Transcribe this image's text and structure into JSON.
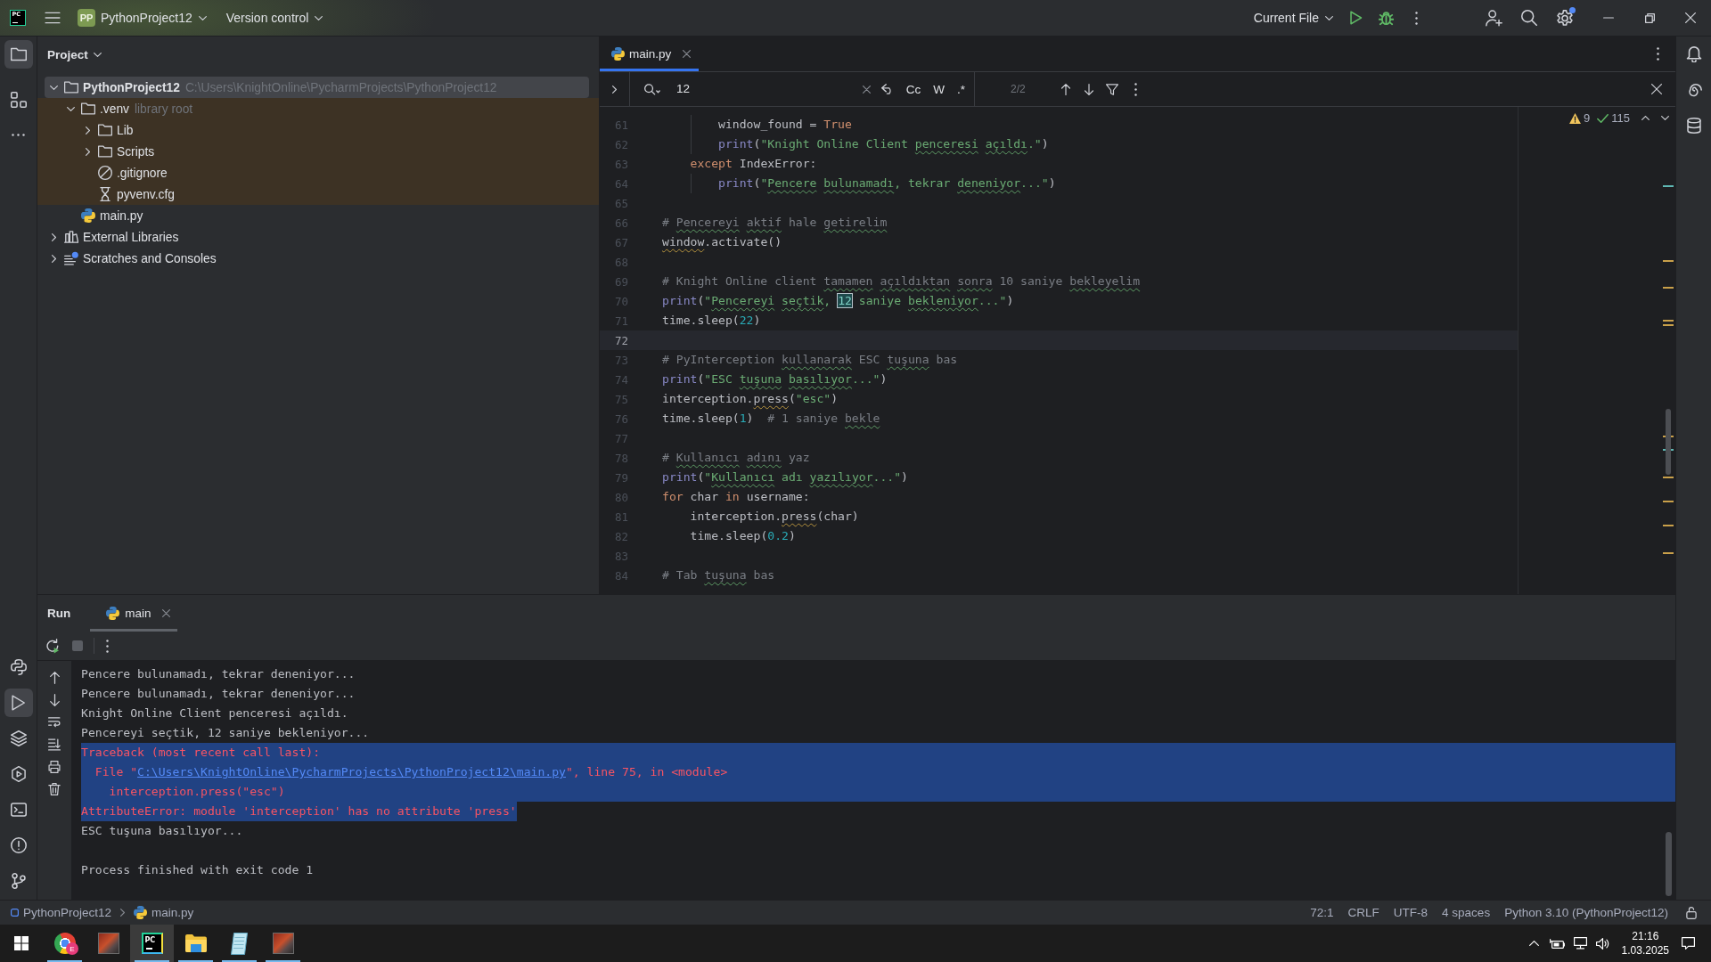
{
  "title_bar": {
    "logo_text": "PC",
    "project_initials": "PP",
    "project": "PythonProject12",
    "vcs": "Version control",
    "run_config": "Current File",
    "settings_notification": true
  },
  "left_toolbar": {
    "top": [
      {
        "kind": "project",
        "selected": true
      },
      {
        "kind": "structure",
        "selected": false
      }
    ],
    "bottom": [
      {
        "kind": "python-console",
        "selected": false
      },
      {
        "kind": "run",
        "selected": true
      },
      {
        "kind": "packages",
        "selected": false
      },
      {
        "kind": "services",
        "selected": false
      },
      {
        "kind": "terminal",
        "selected": false
      },
      {
        "kind": "problems",
        "selected": false
      },
      {
        "kind": "git",
        "selected": false
      }
    ]
  },
  "project_panel": {
    "title": "Project",
    "tree": [
      {
        "kind": "project",
        "label": "PythonProject12",
        "hint": "C:\\Users\\KnightOnline\\PycharmProjects\\PythonProject12",
        "expanded": true,
        "selected": true,
        "library_scope": false,
        "children": [
          {
            "kind": "folder",
            "label": ".venv",
            "hint": "library root",
            "expanded": true,
            "selected": false,
            "library_scope": true,
            "children": [
              {
                "kind": "folder",
                "label": "Lib",
                "expanded": false,
                "selected": false,
                "library_scope": true
              },
              {
                "kind": "folder",
                "label": "Scripts",
                "expanded": false,
                "selected": false,
                "library_scope": true
              },
              {
                "kind": "ignore-file",
                "label": ".gitignore",
                "selected": false,
                "library_scope": true
              },
              {
                "kind": "config-file",
                "label": "pyvenv.cfg",
                "selected": false,
                "library_scope": true
              }
            ]
          },
          {
            "kind": "python-file",
            "label": "main.py",
            "selected": false,
            "library_scope": false
          }
        ]
      },
      {
        "kind": "libraries",
        "label": "External Libraries",
        "expanded": false,
        "selected": false,
        "library_scope": false
      },
      {
        "kind": "scratches",
        "label": "Scratches and Consoles",
        "expanded": false,
        "selected": false,
        "library_scope": false
      }
    ]
  },
  "editor": {
    "tabs": [
      {
        "label": "main.py",
        "selected": true
      }
    ],
    "find": {
      "query": "12",
      "options": [
        {
          "label": "Cc",
          "on": false
        },
        {
          "label": "W",
          "on": false
        },
        {
          "label": ".*",
          "on": false
        }
      ],
      "result": "2/2"
    },
    "inspections": {
      "warnings": "9",
      "passed": "115"
    },
    "lines": [
      {
        "number": "61",
        "current": false,
        "tokens": [
          {
            "kind": "plain",
            "text": "        window_found = "
          },
          {
            "kind": "keyword",
            "text": "True"
          }
        ]
      },
      {
        "number": "62",
        "current": false,
        "tokens": [
          {
            "kind": "builtin",
            "text": "        print"
          },
          {
            "kind": "plain",
            "text": "("
          },
          {
            "kind": "string",
            "text": "\"Knight Online Client "
          },
          {
            "kind": "string",
            "text": "penceresi",
            "typo": true
          },
          {
            "kind": "string",
            "text": " açıldı",
            "typo": true
          },
          {
            "kind": "string",
            "text": ".\""
          },
          {
            "kind": "plain",
            "text": ")"
          }
        ]
      },
      {
        "number": "63",
        "current": false,
        "tokens": [
          {
            "kind": "keyword",
            "text": "    except"
          },
          {
            "kind": "plain",
            "text": " IndexError:"
          }
        ]
      },
      {
        "number": "64",
        "current": false,
        "tokens": [
          {
            "kind": "builtin",
            "text": "        print"
          },
          {
            "kind": "plain",
            "text": "("
          },
          {
            "kind": "string",
            "text": "\""
          },
          {
            "kind": "string",
            "text": "Pencere",
            "typo": true
          },
          {
            "kind": "string",
            "text": " bulunamadı",
            "typo": true
          },
          {
            "kind": "string",
            "text": ", tekrar "
          },
          {
            "kind": "string",
            "text": "deneniyor",
            "typo": true
          },
          {
            "kind": "string",
            "text": "...\""
          },
          {
            "kind": "plain",
            "text": ")"
          }
        ]
      },
      {
        "number": "65",
        "current": false
      },
      {
        "number": "66",
        "current": false,
        "tokens": [
          {
            "kind": "comment",
            "text": "# "
          },
          {
            "kind": "comment",
            "text": "Pencereyi",
            "typo": true
          },
          {
            "kind": "comment",
            "text": " aktif",
            "typo": true
          },
          {
            "kind": "comment",
            "text": " hale "
          },
          {
            "kind": "comment",
            "text": "getirelim",
            "typo": true
          }
        ]
      },
      {
        "number": "67",
        "current": false,
        "tokens": [
          {
            "kind": "plain",
            "text": "window",
            "warning": true
          },
          {
            "kind": "plain",
            "text": ".activate()"
          }
        ]
      },
      {
        "number": "68",
        "current": false
      },
      {
        "number": "69",
        "current": false,
        "tokens": [
          {
            "kind": "comment",
            "text": "# Knight Online client "
          },
          {
            "kind": "comment",
            "text": "tamamen",
            "typo": true
          },
          {
            "kind": "comment",
            "text": " açıldıktan",
            "typo": true
          },
          {
            "kind": "comment",
            "text": " sonra",
            "typo": true
          },
          {
            "kind": "comment",
            "text": " 10 saniye "
          },
          {
            "kind": "comment",
            "text": "bekleyelim",
            "typo": true
          }
        ]
      },
      {
        "number": "70",
        "current": false,
        "tokens": [
          {
            "kind": "builtin",
            "text": "print"
          },
          {
            "kind": "plain",
            "text": "("
          },
          {
            "kind": "string",
            "text": "\""
          },
          {
            "kind": "string",
            "text": "Pencereyi",
            "typo": true
          },
          {
            "kind": "string",
            "text": " seçtik",
            "typo": true
          },
          {
            "kind": "string",
            "text": ", "
          },
          {
            "kind": "match",
            "text": "12"
          },
          {
            "kind": "string",
            "text": " saniye "
          },
          {
            "kind": "string",
            "text": "bekleniyor",
            "typo": true
          },
          {
            "kind": "string",
            "text": "...\""
          },
          {
            "kind": "plain",
            "text": ")"
          }
        ]
      },
      {
        "number": "71",
        "current": false,
        "tokens": [
          {
            "kind": "plain",
            "text": "time.sleep("
          },
          {
            "kind": "number",
            "text": "22"
          },
          {
            "kind": "plain",
            "text": ")"
          }
        ]
      },
      {
        "number": "72",
        "current": true
      },
      {
        "number": "73",
        "current": false,
        "tokens": [
          {
            "kind": "comment",
            "text": "# PyInterception "
          },
          {
            "kind": "comment",
            "text": "kullanarak",
            "typo": true
          },
          {
            "kind": "comment",
            "text": " ESC "
          },
          {
            "kind": "comment",
            "text": "tuşuna",
            "typo": true
          },
          {
            "kind": "comment",
            "text": " bas"
          }
        ]
      },
      {
        "number": "74",
        "current": false,
        "tokens": [
          {
            "kind": "builtin",
            "text": "print"
          },
          {
            "kind": "plain",
            "text": "("
          },
          {
            "kind": "string",
            "text": "\"ESC "
          },
          {
            "kind": "string",
            "text": "tuşuna",
            "typo": true
          },
          {
            "kind": "string",
            "text": " basılıyor",
            "typo": true
          },
          {
            "kind": "string",
            "text": "...\""
          },
          {
            "kind": "plain",
            "text": ")"
          }
        ]
      },
      {
        "number": "75",
        "current": false,
        "tokens": [
          {
            "kind": "plain",
            "text": "interception."
          },
          {
            "kind": "plain",
            "text": "press",
            "warning": true
          },
          {
            "kind": "plain",
            "text": "("
          },
          {
            "kind": "string",
            "text": "\"esc\""
          },
          {
            "kind": "plain",
            "text": ")"
          }
        ]
      },
      {
        "number": "76",
        "current": false,
        "tokens": [
          {
            "kind": "plain",
            "text": "time.sleep("
          },
          {
            "kind": "number",
            "text": "1"
          },
          {
            "kind": "plain",
            "text": ")  "
          },
          {
            "kind": "comment",
            "text": "# 1 saniye "
          },
          {
            "kind": "comment",
            "text": "bekle",
            "typo": true
          }
        ]
      },
      {
        "number": "77",
        "current": false
      },
      {
        "number": "78",
        "current": false,
        "tokens": [
          {
            "kind": "comment",
            "text": "# "
          },
          {
            "kind": "comment",
            "text": "Kullanıcı",
            "typo": true
          },
          {
            "kind": "comment",
            "text": " adını",
            "typo": true
          },
          {
            "kind": "comment",
            "text": " yaz"
          }
        ]
      },
      {
        "number": "79",
        "current": false,
        "tokens": [
          {
            "kind": "builtin",
            "text": "print"
          },
          {
            "kind": "plain",
            "text": "("
          },
          {
            "kind": "string",
            "text": "\""
          },
          {
            "kind": "string",
            "text": "Kullanıcı",
            "typo": true
          },
          {
            "kind": "string",
            "text": " adı "
          },
          {
            "kind": "string",
            "text": "yazılıyor",
            "typo": true
          },
          {
            "kind": "string",
            "text": "...\""
          },
          {
            "kind": "plain",
            "text": ")"
          }
        ]
      },
      {
        "number": "80",
        "current": false,
        "tokens": [
          {
            "kind": "keyword",
            "text": "for"
          },
          {
            "kind": "plain",
            "text": " char "
          },
          {
            "kind": "keyword",
            "text": "in"
          },
          {
            "kind": "plain",
            "text": " username:"
          }
        ]
      },
      {
        "number": "81",
        "current": false,
        "tokens": [
          {
            "kind": "plain",
            "text": "    interception."
          },
          {
            "kind": "plain",
            "text": "press",
            "warning": true
          },
          {
            "kind": "plain",
            "text": "(char)"
          }
        ]
      },
      {
        "number": "82",
        "current": false,
        "tokens": [
          {
            "kind": "plain",
            "text": "    time.sleep("
          },
          {
            "kind": "number",
            "text": "0.2"
          },
          {
            "kind": "plain",
            "text": ")"
          }
        ]
      },
      {
        "number": "83",
        "current": false
      },
      {
        "number": "84",
        "current": false,
        "tokens": [
          {
            "kind": "comment",
            "text": "# Tab "
          },
          {
            "kind": "comment",
            "text": "tuşuna",
            "typo": true
          },
          {
            "kind": "comment",
            "text": " bas"
          }
        ]
      }
    ]
  },
  "run_panel": {
    "title": "Run",
    "tabs": [
      {
        "label": "main",
        "selected": true
      }
    ],
    "stop_enabled": false,
    "console": [
      {
        "kind": "stdout",
        "selected": false,
        "text": "Pencere bulunamadı, tekrar deneniyor..."
      },
      {
        "kind": "stdout",
        "selected": false,
        "text": "Pencere bulunamadı, tekrar deneniyor..."
      },
      {
        "kind": "stdout",
        "selected": false,
        "text": "Knight Online Client penceresi açıldı."
      },
      {
        "kind": "stdout",
        "selected": false,
        "text": "Pencereyi seçtik, 12 saniye bekleniyor..."
      },
      {
        "kind": "stderr",
        "selected": true,
        "text": "Traceback (most recent call last):"
      },
      {
        "kind": "stderr",
        "selected": true,
        "segments": [
          {
            "text": "  File \"",
            "link": false
          },
          {
            "text": "C:\\Users\\KnightOnline\\PycharmProjects\\PythonProject12\\main.py",
            "link": true
          },
          {
            "text": "\", line 75, in <module>",
            "link": false
          }
        ]
      },
      {
        "kind": "stderr",
        "selected": true,
        "text": "    interception.press(\"esc\")"
      },
      {
        "kind": "stderr",
        "selected": true,
        "text": "AttributeError: module 'interception' has no attribute 'press'"
      },
      {
        "kind": "stdout",
        "selected": false,
        "text": "ESC tuşuna basılıyor..."
      },
      {
        "kind": "system",
        "selected": false,
        "text": "Process finished with exit code 1"
      }
    ]
  },
  "status_bar": {
    "breadcrumb": [
      {
        "kind": "project",
        "label": "PythonProject12"
      },
      {
        "kind": "python-file",
        "label": "main.py"
      }
    ],
    "widgets": [
      "72:1",
      "CRLF",
      "UTF-8",
      "4 spaces",
      "Python 3.10 (PythonProject12)"
    ]
  },
  "taskbar": {
    "apps": [
      {
        "kind": "browser",
        "badge": "E",
        "running": true,
        "active": false
      },
      {
        "kind": "game",
        "running": false,
        "active": false
      },
      {
        "kind": "ide",
        "logo_text": "PC",
        "running": true,
        "active": true
      },
      {
        "kind": "files",
        "running": true,
        "active": false
      },
      {
        "kind": "notepad",
        "running": true,
        "active": false
      },
      {
        "kind": "game",
        "running": true,
        "active": false
      }
    ],
    "clock": {
      "time": "21:16",
      "date": "1.03.2025"
    }
  }
}
